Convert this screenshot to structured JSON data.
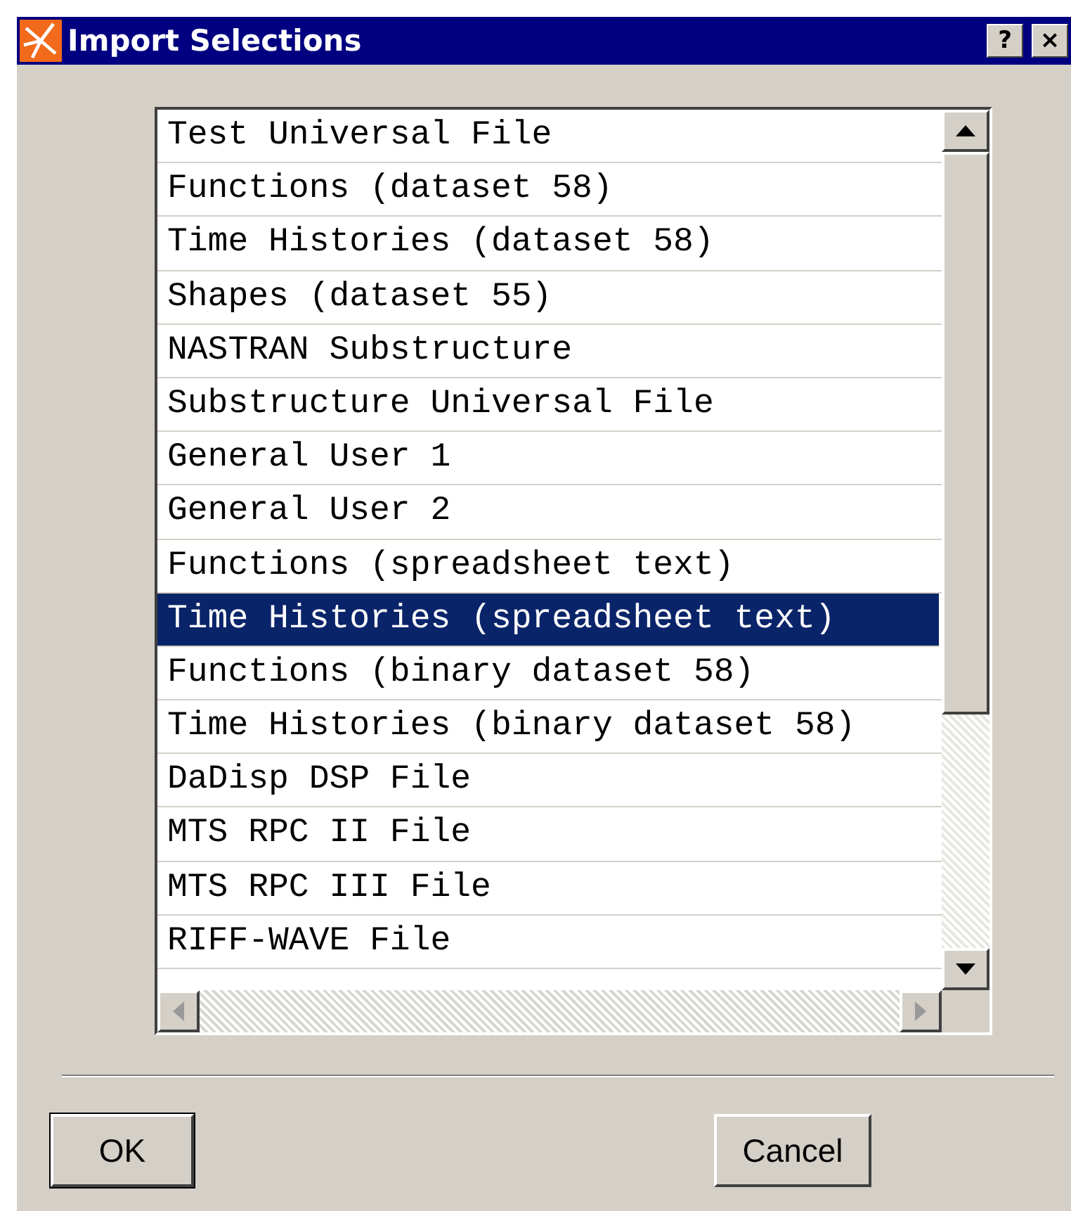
{
  "window": {
    "title": "Import Selections",
    "help_button": "?",
    "close_button": "×"
  },
  "list": {
    "items": [
      {
        "label": "Test Universal File",
        "selected": false
      },
      {
        "label": "Functions (dataset 58)",
        "selected": false
      },
      {
        "label": "Time Histories (dataset 58)",
        "selected": false
      },
      {
        "label": "Shapes (dataset 55)",
        "selected": false
      },
      {
        "label": "NASTRAN Substructure",
        "selected": false
      },
      {
        "label": "Substructure Universal File",
        "selected": false
      },
      {
        "label": "General User 1",
        "selected": false
      },
      {
        "label": "General User 2",
        "selected": false
      },
      {
        "label": "Functions (spreadsheet text)",
        "selected": false
      },
      {
        "label": "Time Histories (spreadsheet text)",
        "selected": true
      },
      {
        "label": "Functions (binary dataset 58)",
        "selected": false
      },
      {
        "label": "Time Histories (binary dataset 58)",
        "selected": false
      },
      {
        "label": "DaDisp DSP File",
        "selected": false
      },
      {
        "label": "MTS RPC II File",
        "selected": false
      },
      {
        "label": "MTS RPC III File",
        "selected": false
      },
      {
        "label": "RIFF-WAVE File",
        "selected": false
      }
    ]
  },
  "buttons": [
    {
      "label": "OK",
      "kind": "default"
    },
    {
      "label": "Cancel",
      "kind": "normal"
    }
  ]
}
